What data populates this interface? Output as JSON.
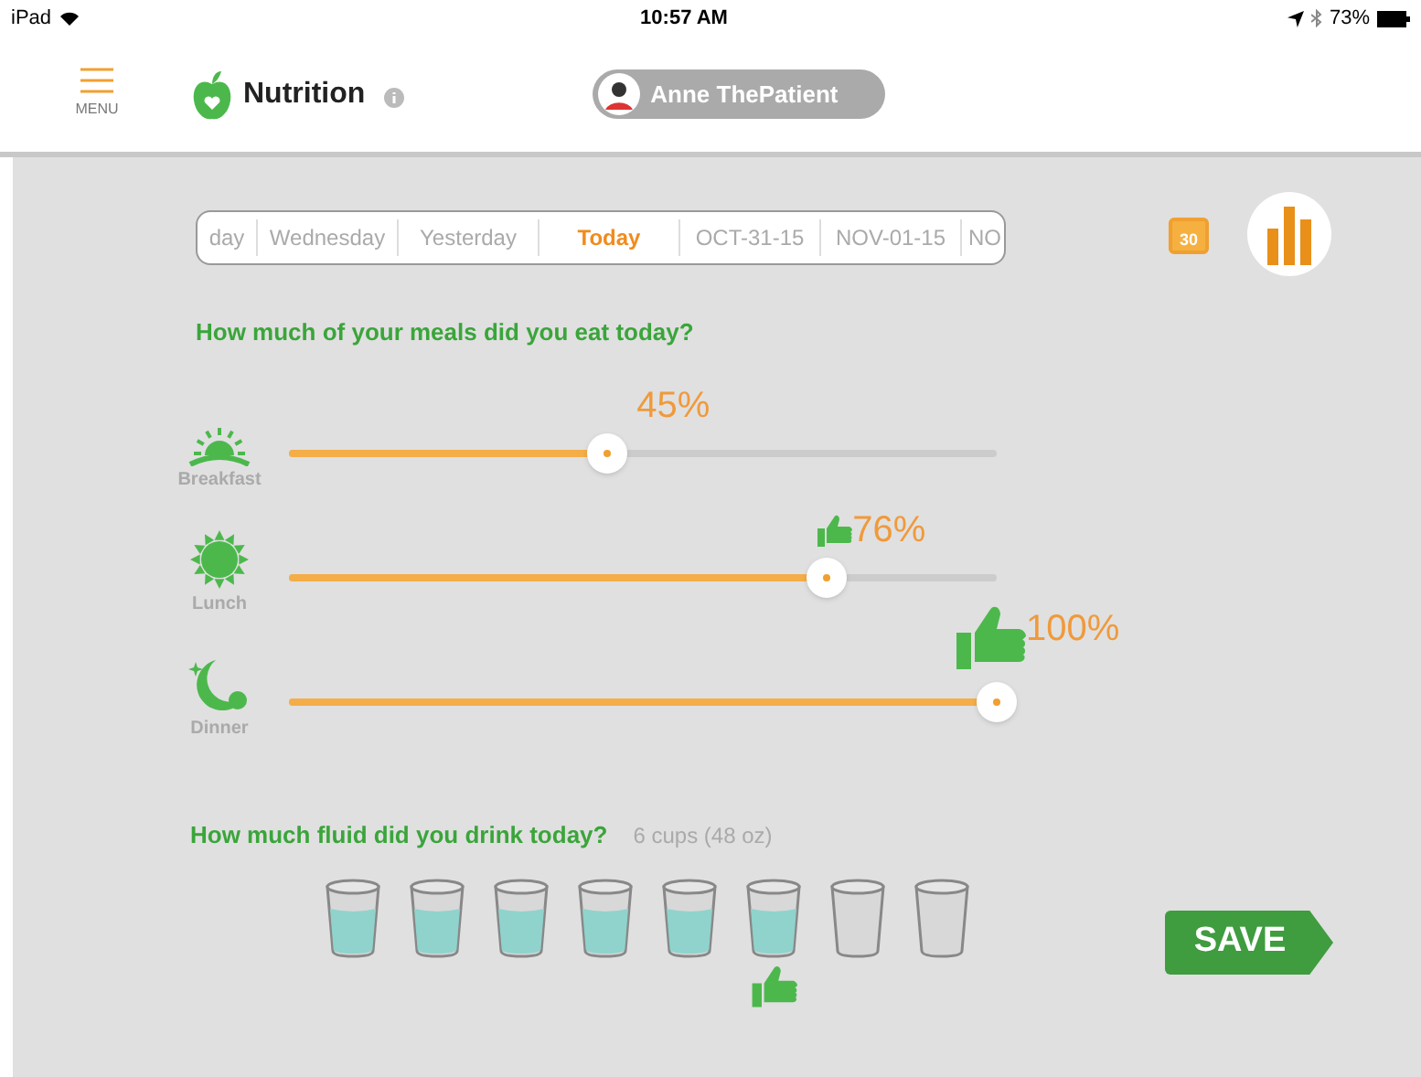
{
  "status_bar": {
    "device": "iPad",
    "time": "10:57 AM",
    "battery": "73%"
  },
  "header": {
    "menu_label": "MENU",
    "title": "Nutrition",
    "patient": "Anne ThePatient"
  },
  "date_tabs": [
    {
      "label": "day",
      "selected": false
    },
    {
      "label": "Wednesday",
      "selected": false
    },
    {
      "label": "Yesterday",
      "selected": false
    },
    {
      "label": "Today",
      "selected": true
    },
    {
      "label": "OCT-31-15",
      "selected": false
    },
    {
      "label": "NOV-01-15",
      "selected": false
    },
    {
      "label": "NO",
      "selected": false
    }
  ],
  "calendar_day": "30",
  "meals": {
    "question": "How much of your meals did you eat today?",
    "items": [
      {
        "kind": "breakfast",
        "name": "Breakfast",
        "level": 0.45,
        "reading": "45%",
        "thumbs_up": false
      },
      {
        "kind": "lunch",
        "name": "Lunch",
        "level": 0.76,
        "reading": "76%",
        "thumbs_up": true
      },
      {
        "kind": "dinner",
        "name": "Dinner",
        "level": 1,
        "reading": "100%",
        "thumbs_up": true
      }
    ]
  },
  "fluid": {
    "question": "How much fluid did you drink today?",
    "amount": "6 cups (48 oz)",
    "cups": [
      {
        "filled": true,
        "thumbs_up": false
      },
      {
        "filled": true,
        "thumbs_up": false
      },
      {
        "filled": true,
        "thumbs_up": false
      },
      {
        "filled": true,
        "thumbs_up": false
      },
      {
        "filled": true,
        "thumbs_up": false
      },
      {
        "filled": true,
        "thumbs_up": true
      },
      {
        "filled": false,
        "thumbs_up": false
      },
      {
        "filled": false,
        "thumbs_up": false
      }
    ]
  },
  "save_button": "SAVE"
}
